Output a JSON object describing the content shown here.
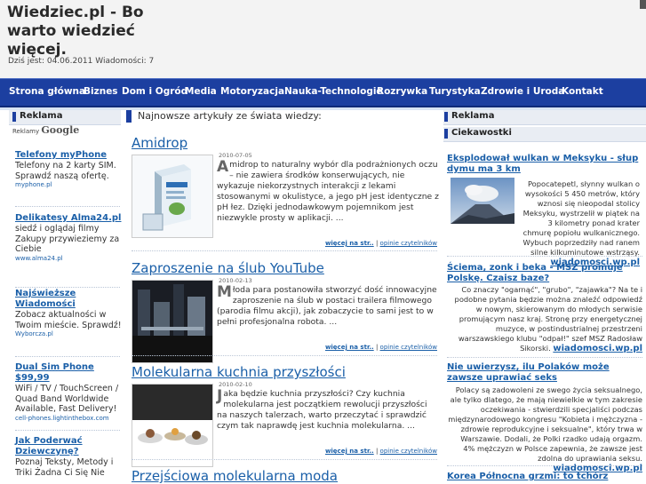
{
  "header": {
    "title": "Wiedziec.pl - Bo warto wiedzieć więcej.",
    "today": "Dziś jest: 04.06.2011 Wiadomości: 7"
  },
  "nav": [
    "Strona główna",
    "Biznes",
    "Dom i Ogród",
    "Media",
    "Motoryzacja",
    "Nauka-Technologie",
    "Rozrywka",
    "Turystyka",
    "Zdrowie i Uroda",
    "Kontakt"
  ],
  "left": {
    "heading": "Reklama",
    "ads_by": "Reklamy",
    "ads_by_brand": "Google",
    "ads": [
      {
        "title": "Telefony myPhone",
        "desc": "Telefony na 2 karty SIM. Sprawdź naszą ofertę.",
        "url": "myphone.pl"
      },
      {
        "title": "Delikatesy Alma24.pl",
        "desc": "siedź i oglądaj filmy Zakupy przywieziemy za Ciebie",
        "url": "www.alma24.pl"
      },
      {
        "title": "Najświeższe Wiadomości",
        "desc": "Zobacz aktualności w Twoim mieście. Sprawdź!",
        "url": "Wyborcza.pl"
      },
      {
        "title": "Dual Sim Phone $99,99",
        "desc": "WiFi / TV / TouchScreen / Quad Band Worldwide Available, Fast Delivery!",
        "url": "cell-phones.lightinthebox.com"
      },
      {
        "title": "Jak Poderwać Dziewczynę?",
        "desc": "Poznaj Teksty, Metody i Triki Żadna Ci Się Nie",
        "url": ""
      }
    ]
  },
  "center": {
    "heading": "Najnowsze artykuły ze świata wiedzy:",
    "more_label": "więcej na str..",
    "sep": "|",
    "opinions_label": "opinie czytelników",
    "articles": [
      {
        "title": "Amidrop",
        "date": "2010-07-05",
        "dropcap": "A",
        "text": "midrop to naturalny wybór dla podrażnionych oczu – nie zawiera środków konserwujących, nie wykazuje niekorzystnych interakcji z lekami stosowanymi w okulistyce, a jego pH jest identyczne z pH łez. Dzięki jednodawkowym pojemnikom jest niezwykle prosty w aplikacji. ..."
      },
      {
        "title": "Zaproszenie na ślub YouTube",
        "date": "2010-02-13",
        "dropcap": "M",
        "text": "łoda para postanowiła stworzyć dość innowacyjne zaproszenie na ślub w postaci trailera filmowego (parodia filmu akcji), jak zobaczycie to sami jest to w pełni profesjonalna robota. ..."
      },
      {
        "title": "Molekularna kuchnia przyszłości",
        "date": "2010-02-10",
        "dropcap": "J",
        "text": "aka będzie kuchnia przyszłości? Czy kuchnia molekularna jest początkiem rewolucji przyszłości na naszych talerzach, warto przeczytać i sprawdzić czym tak naprawdę jest kuchnia molekularna. ..."
      },
      {
        "title": "Przejściowa molekularna moda",
        "date": "",
        "dropcap": "",
        "text": ""
      }
    ]
  },
  "right": {
    "heading_ad": "Reklama",
    "heading_cur": "Ciekawostki",
    "items": [
      {
        "title": "Eksplodował wulkan w Meksyku - słup dymu ma 3 km",
        "text": "Popocatepetl, słynny wulkan o wysokości 5 450 metrów, który wznosi się nieopodal stolicy Meksyku, wystrzelił w piątek na 3 kilometry ponad krater chmurę popiołu wulkanicznego. Wybuch poprzedziły nad ranem silne kilkuminutowe wstrząsy.",
        "source": "wiadomosci.wp.pl"
      },
      {
        "title": "Ściema, zonk i beka - MSZ promuje Polskę. Czaisz baze?",
        "text": "Co znaczy \"ogarnąć\", \"grubo\", \"zajawka\"? Na te i podobne pytania będzie można znaleźć odpowiedź w nowym, skierowanym do młodych serwisie promującym nasz kraj. Stronę przy energetycznej muzyce, w postindustrialnej przestrzeni warszawskiego klubu \"odpał!\" szef MSZ Radosław Sikorski.",
        "source": "wiadomosci.wp.pl"
      },
      {
        "title": "Nie uwierzysz, ilu Polaków może zawsze uprawiać seks",
        "text": "Polacy są zadowoleni ze swego życia seksualnego, ale tylko dlatego, że mają niewielkie w tym zakresie oczekiwania - stwierdzili specjaliści podczas międzynarodowego kongresu \"Kobieta i mężczyzna - zdrowie reprodukcyjne i seksualne\", który trwa w Warszawie. Dodali, że Polki rzadko udają orgazm. 4% mężczyzn w Polsce zapewnia, że zawsze jest zdolna do uprawiania seksu.",
        "source": "wiadomosci.wp.pl"
      },
      {
        "title": "Korea Północna grzmi: to tchórz",
        "text": "",
        "source": ""
      }
    ]
  },
  "colors": {
    "nav_bg": "#1c3fa0",
    "link": "#1a5fa8",
    "header_bg": "#f3f3f3"
  },
  "icons": [
    "drop-cap",
    "article-thumbnail",
    "volcano-photo"
  ]
}
